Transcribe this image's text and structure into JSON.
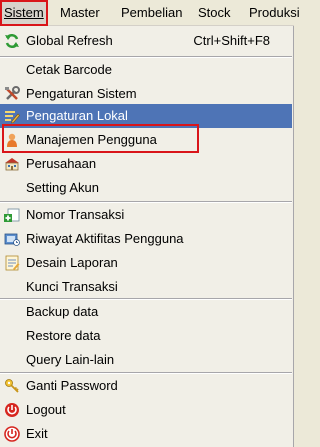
{
  "menubar": {
    "items": [
      {
        "label": "Sistem",
        "active": true
      },
      {
        "label": "Master"
      },
      {
        "label": "Pembelian"
      },
      {
        "label": "Stock"
      },
      {
        "label": "Produksi"
      }
    ]
  },
  "menu": {
    "items": [
      {
        "label": "Global Refresh",
        "shortcut": "Ctrl+Shift+F8",
        "icon": "refresh-icon"
      },
      {
        "label": "Cetak Barcode"
      },
      {
        "label": "Pengaturan Sistem",
        "icon": "tools-icon"
      },
      {
        "label": "Pengaturan Lokal",
        "icon": "edit-settings-icon",
        "selected": true
      },
      {
        "label": "Manajemen Pengguna",
        "icon": "user-icon"
      },
      {
        "label": "Perusahaan",
        "icon": "building-icon"
      },
      {
        "label": "Setting Akun"
      },
      {
        "label": "Nomor Transaksi",
        "icon": "add-number-icon"
      },
      {
        "label": "Riwayat Aktifitas Pengguna",
        "icon": "history-icon"
      },
      {
        "label": "Desain Laporan",
        "icon": "report-design-icon"
      },
      {
        "label": "Kunci Transaksi"
      },
      {
        "label": "Backup data"
      },
      {
        "label": "Restore data"
      },
      {
        "label": "Query Lain-lain"
      },
      {
        "label": "Ganti Password",
        "icon": "key-icon"
      },
      {
        "label": "Logout",
        "icon": "logout-icon"
      },
      {
        "label": "Exit",
        "icon": "exit-icon"
      }
    ]
  },
  "colors": {
    "selection": "#4e74b6",
    "highlight_border": "#d9151a",
    "menu_background": "#f1efe7"
  }
}
